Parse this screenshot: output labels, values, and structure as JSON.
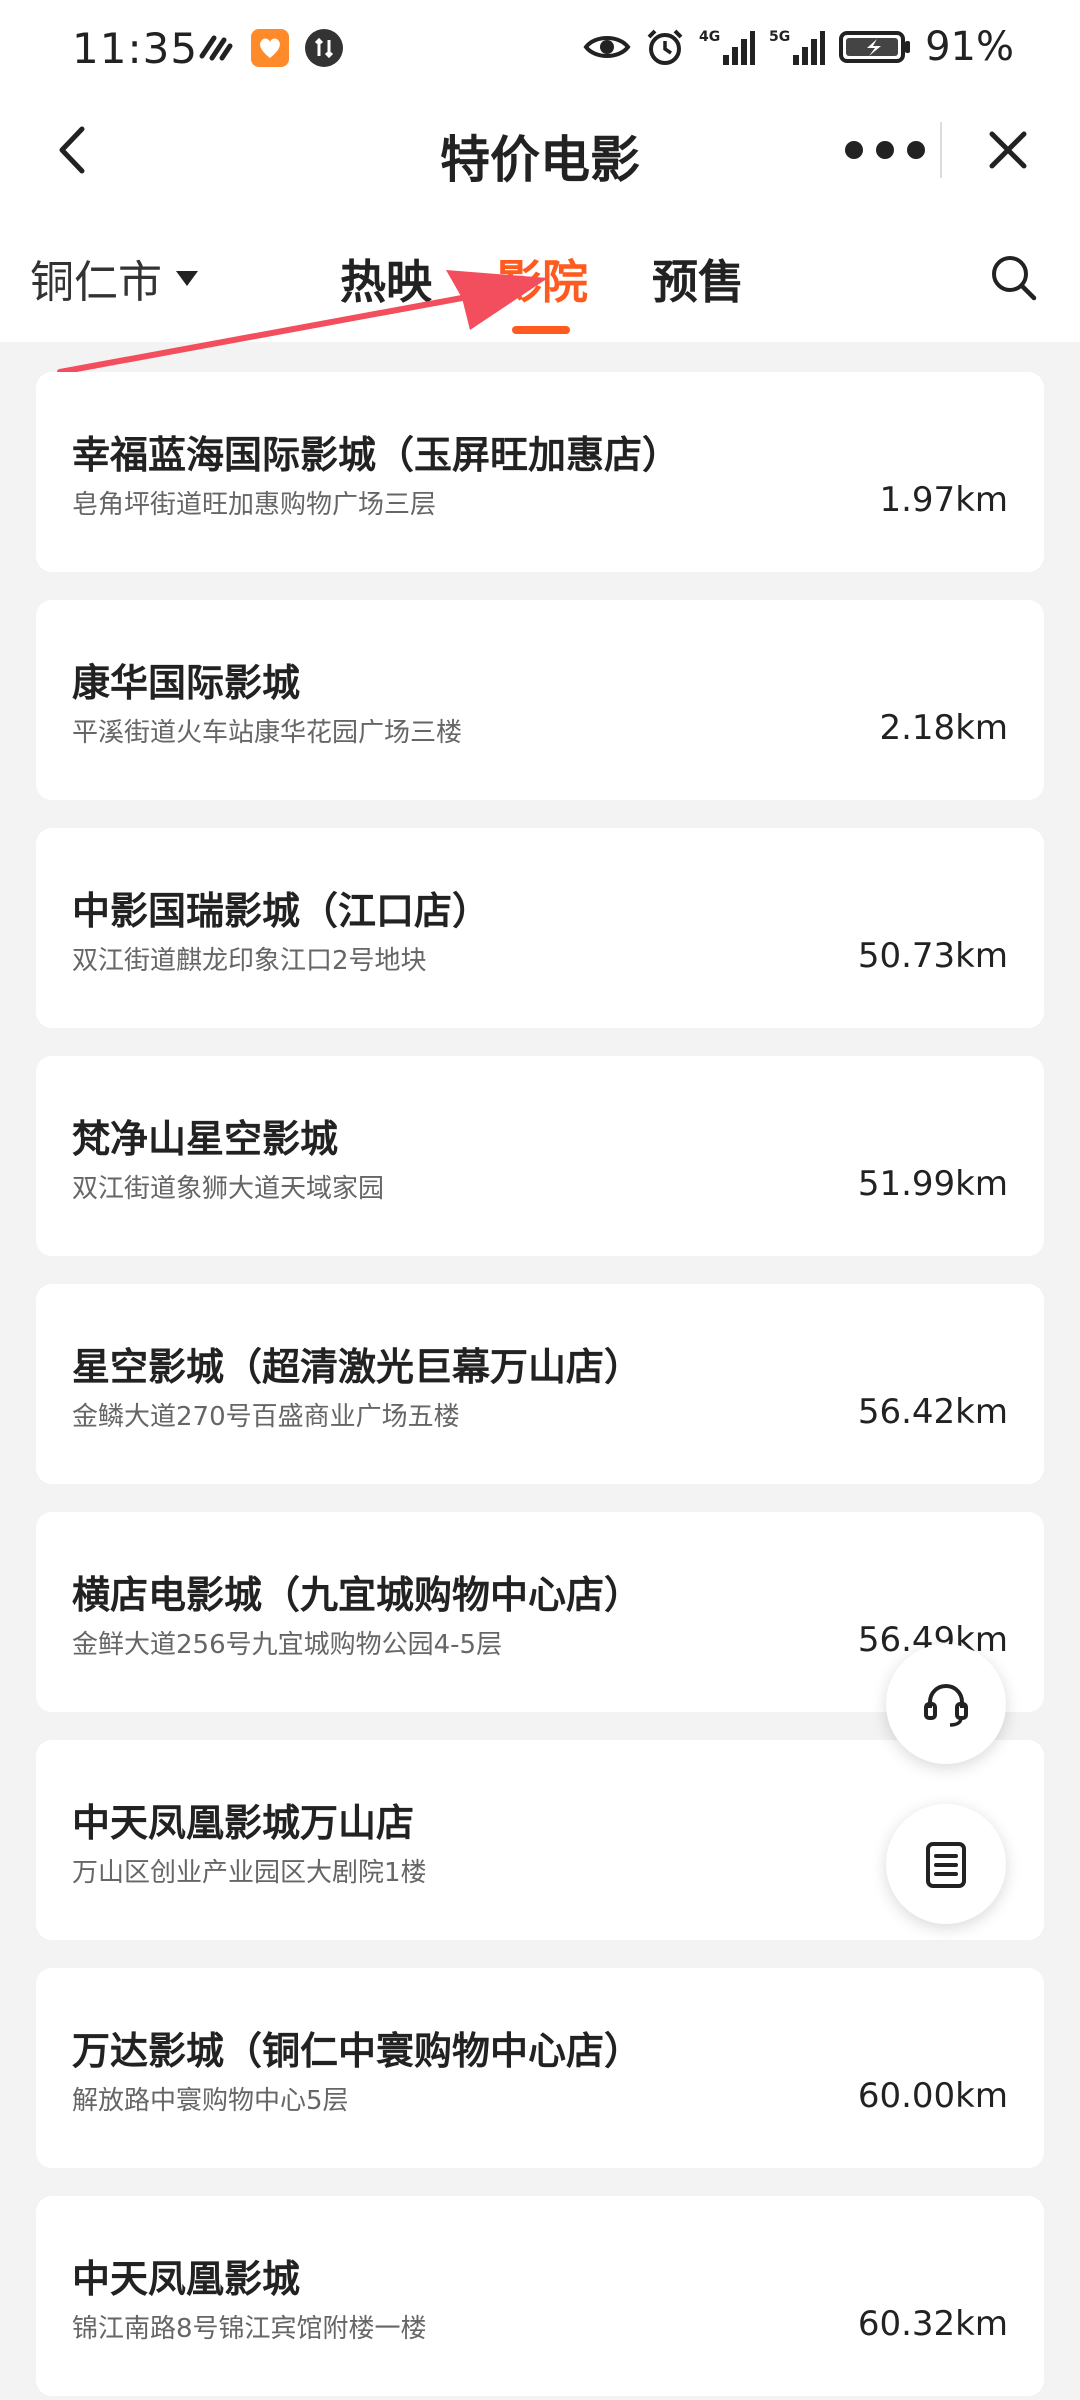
{
  "status_bar": {
    "time": "11:35",
    "battery": "91%",
    "icons": [
      "vibrate-icon",
      "app-badge-icon",
      "data-sync-icon",
      "eye-icon",
      "alarm-icon",
      "signal-4g-icon",
      "signal-5g-icon",
      "battery-icon"
    ],
    "signal_labels": [
      "4G",
      "5G"
    ]
  },
  "nav": {
    "title": "特价电影",
    "back_icon": "chevron-left-icon",
    "more_icon": "more-dots-icon",
    "close_icon": "close-icon"
  },
  "tabs": {
    "city": "铜仁市",
    "items": [
      {
        "label": "热映",
        "active": false
      },
      {
        "label": "影院",
        "active": true
      },
      {
        "label": "预售",
        "active": false
      }
    ],
    "search_icon": "search-icon"
  },
  "colors": {
    "accent": "#ff5a1f",
    "annotation_arrow": "#f24e5e"
  },
  "cinemas": [
    {
      "name": "幸福蓝海国际影城（玉屏旺加惠店）",
      "address": "皂角坪街道旺加惠购物广场三层",
      "distance": "1.97km"
    },
    {
      "name": "康华国际影城",
      "address": "平溪街道火车站康华花园广场三楼",
      "distance": "2.18km"
    },
    {
      "name": "中影国瑞影城（江口店）",
      "address": "双江街道麒龙印象江口2号地块",
      "distance": "50.73km"
    },
    {
      "name": "梵净山星空影城",
      "address": "双江街道象狮大道天域家园",
      "distance": "51.99km"
    },
    {
      "name": "星空影城（超清激光巨幕万山店）",
      "address": "金鳞大道270号百盛商业广场五楼",
      "distance": "56.42km"
    },
    {
      "name": "横店电影城（九宜城购物中心店）",
      "address": "金鲜大道256号九宜城购物公园4-5层",
      "distance": "56.49km"
    },
    {
      "name": "中天凤凰影城万山店",
      "address": "万山区创业产业园区大剧院1楼",
      "distance": ""
    },
    {
      "name": "万达影城（铜仁中寰购物中心店）",
      "address": "解放路中寰购物中心5层",
      "distance": "60.00km"
    },
    {
      "name": "中天凤凰影城",
      "address": "锦江南路8号锦江宾馆附楼一楼",
      "distance": "60.32km"
    }
  ],
  "floating": {
    "service_icon": "headset-icon",
    "orders_icon": "order-list-icon"
  }
}
